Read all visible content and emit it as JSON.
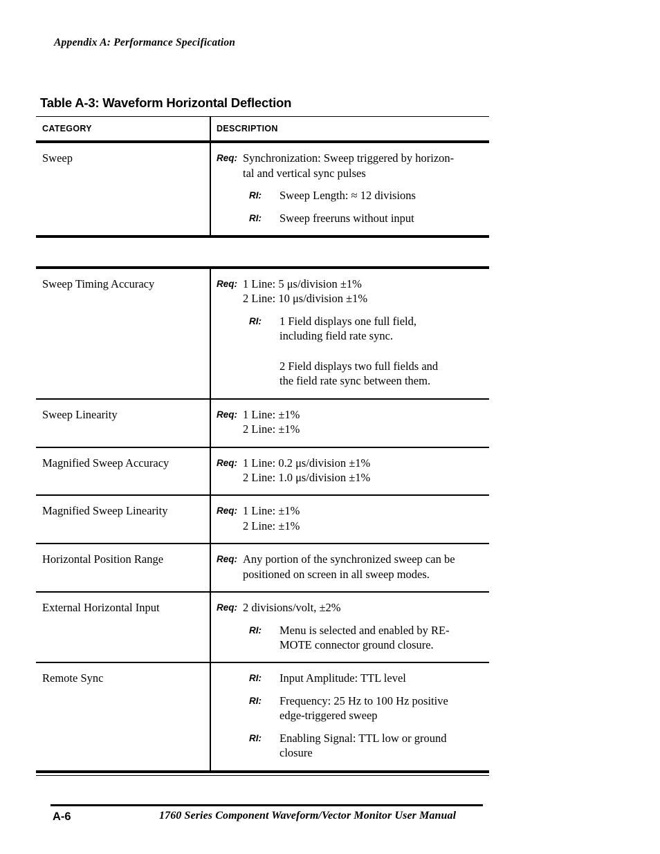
{
  "page": {
    "running_head": "Appendix A: Performance Specification",
    "table_title": "Table A-3: Waveform Horizontal Deflection"
  },
  "table": {
    "headers": {
      "category": "CATEGORY",
      "description": "DESCRIPTION"
    },
    "rows": [
      {
        "category": "Sweep",
        "entries": [
          {
            "label": "Req:",
            "kind": "req",
            "text": "Synchronization:  Sweep triggered by horizon-\ntal and vertical sync pulses"
          },
          {
            "label": "RI:",
            "kind": "ri",
            "text": "Sweep Length:  ≈ 12 divisions"
          },
          {
            "label": "RI:",
            "kind": "ri",
            "text": "Sweep freeruns without input"
          }
        ]
      },
      {
        "category": "Sweep Timing Accuracy",
        "entries": [
          {
            "label": "Req:",
            "kind": "req",
            "text": "1 Line:  5 μs/division  ±1%\n2 Line:  10 μs/division  ±1%"
          },
          {
            "label": "RI:",
            "kind": "ri",
            "text": "1 Field displays one full field,\nincluding field rate sync."
          },
          {
            "label": "",
            "kind": "ri-cont",
            "text": "2 Field displays two full fields and\nthe field rate sync between them."
          }
        ]
      },
      {
        "category": "Sweep Linearity",
        "entries": [
          {
            "label": "Req:",
            "kind": "req",
            "text": "1 Line:  ±1%\n2 Line:  ±1%"
          }
        ]
      },
      {
        "category": "Magnified Sweep Accuracy",
        "entries": [
          {
            "label": "Req:",
            "kind": "req",
            "text": "1 Line:  0.2 μs/division  ±1%\n2 Line:  1.0 μs/division  ±1%"
          }
        ]
      },
      {
        "category": "Magnified Sweep Linearity",
        "entries": [
          {
            "label": "Req:",
            "kind": "req",
            "text": "1 Line:  ±1%\n2 Line:  ±1%"
          }
        ]
      },
      {
        "category": "Horizontal Position Range",
        "entries": [
          {
            "label": "Req:",
            "kind": "req",
            "text": "Any portion of the synchronized sweep can be\npositioned on screen in all sweep modes."
          }
        ]
      },
      {
        "category": "External Horizontal Input",
        "entries": [
          {
            "label": "Req:",
            "kind": "req",
            "text": "2 divisions/volt,  ±2%"
          },
          {
            "label": "RI:",
            "kind": "ri",
            "text": "Menu is selected and enabled by RE-\nMOTE connector ground closure."
          }
        ]
      },
      {
        "category": "Remote Sync",
        "entries": [
          {
            "label": "RI:",
            "kind": "ri",
            "text": "Input Amplitude:  TTL level"
          },
          {
            "label": "RI:",
            "kind": "ri",
            "text": "Frequency: 25 Hz to 100 Hz positive\nedge-triggered sweep"
          },
          {
            "label": "RI:",
            "kind": "ri",
            "text": "Enabling Signal:  TTL low or ground\nclosure"
          }
        ]
      }
    ]
  },
  "footer": {
    "page_number": "A-6",
    "manual_title": "1760 Series Component Waveform/Vector Monitor User Manual"
  }
}
